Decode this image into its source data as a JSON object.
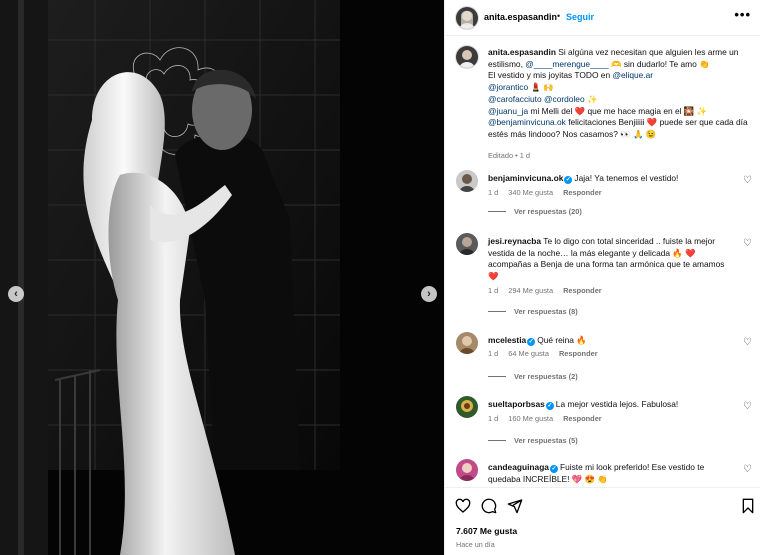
{
  "post": {
    "username": "anita.espasandin",
    "separator": "•",
    "follow_label": "Seguir",
    "more_label": "•••",
    "prev_label": "‹",
    "next_label": "›"
  },
  "caption": {
    "username": "anita.espasandin",
    "t1": " Si algúna vez necesitan que alguien les arme un estilismo, ",
    "m1": "@____merengue____",
    "e1": " 🫶 ",
    "t2": "sin dudarlo! Te amo 👏",
    "t3": "El vestido y mis joyitas TODO en ",
    "m2": "@elique.ar",
    "m3": "@jorantico",
    "e2": " 💄 🙌",
    "m4": "@carofacciuto",
    "m5": "@cordoleo",
    "e3": " ✨",
    "m6": "@juanu_ja",
    "t4": " mi Melli del ❤️  que me hace magia en el 🎇 ✨",
    "m7": "@benjaminvicuna.ok",
    "t5": " felicitaciones Benjiiiii ❤️ puede ser que cada día estés más lindooo? Nos casamos? 👀 🙏 😉",
    "meta": "Editado • 1 d"
  },
  "comments": [
    {
      "username": "benjaminvicuna.ok",
      "verified": true,
      "text": "Jaja! Ya tenemos el vestido!",
      "time": "1 d",
      "likes": "340 Me gusta",
      "reply": "Responder",
      "replies": "Ver respuestas (20)"
    },
    {
      "username": "jesi.reynacba",
      "verified": false,
      "text": "Te lo digo con total sinceridad .. fuiste la mejor vestida de la noche… la más elegante y delicada 🔥 ❤️ acompañas a Benja de una forma tan armónica que te amamos ❤️",
      "time": "1 d",
      "likes": "294 Me gusta",
      "reply": "Responder",
      "replies": "Ver respuestas (8)"
    },
    {
      "username": "mcelestia",
      "verified": true,
      "text": "Qué reina 🔥",
      "time": "1 d",
      "likes": "64 Me gusta",
      "reply": "Responder",
      "replies": "Ver respuestas (2)"
    },
    {
      "username": "sueltaporbsas",
      "verified": true,
      "text": "La mejor vestida lejos. Fabulosa!",
      "time": "1 d",
      "likes": "160 Me gusta",
      "reply": "Responder",
      "replies": "Ver respuestas (5)"
    },
    {
      "username": "candeaguinaga",
      "verified": true,
      "text": "Fuiste mi look preferido! Ese vestido te quedaba INCREÍBLE! 💖 😍 👏"
    }
  ],
  "footer": {
    "likes": "7.607 Me gusta",
    "time": "Hace un día"
  },
  "icons": [
    "heart-icon",
    "comment-icon",
    "share-icon",
    "save-icon",
    "more-icon",
    "verified-icon"
  ],
  "colors": {
    "link": "#00376b",
    "follow": "#0095f6",
    "verified": "#0095f6",
    "muted": "#737373"
  }
}
